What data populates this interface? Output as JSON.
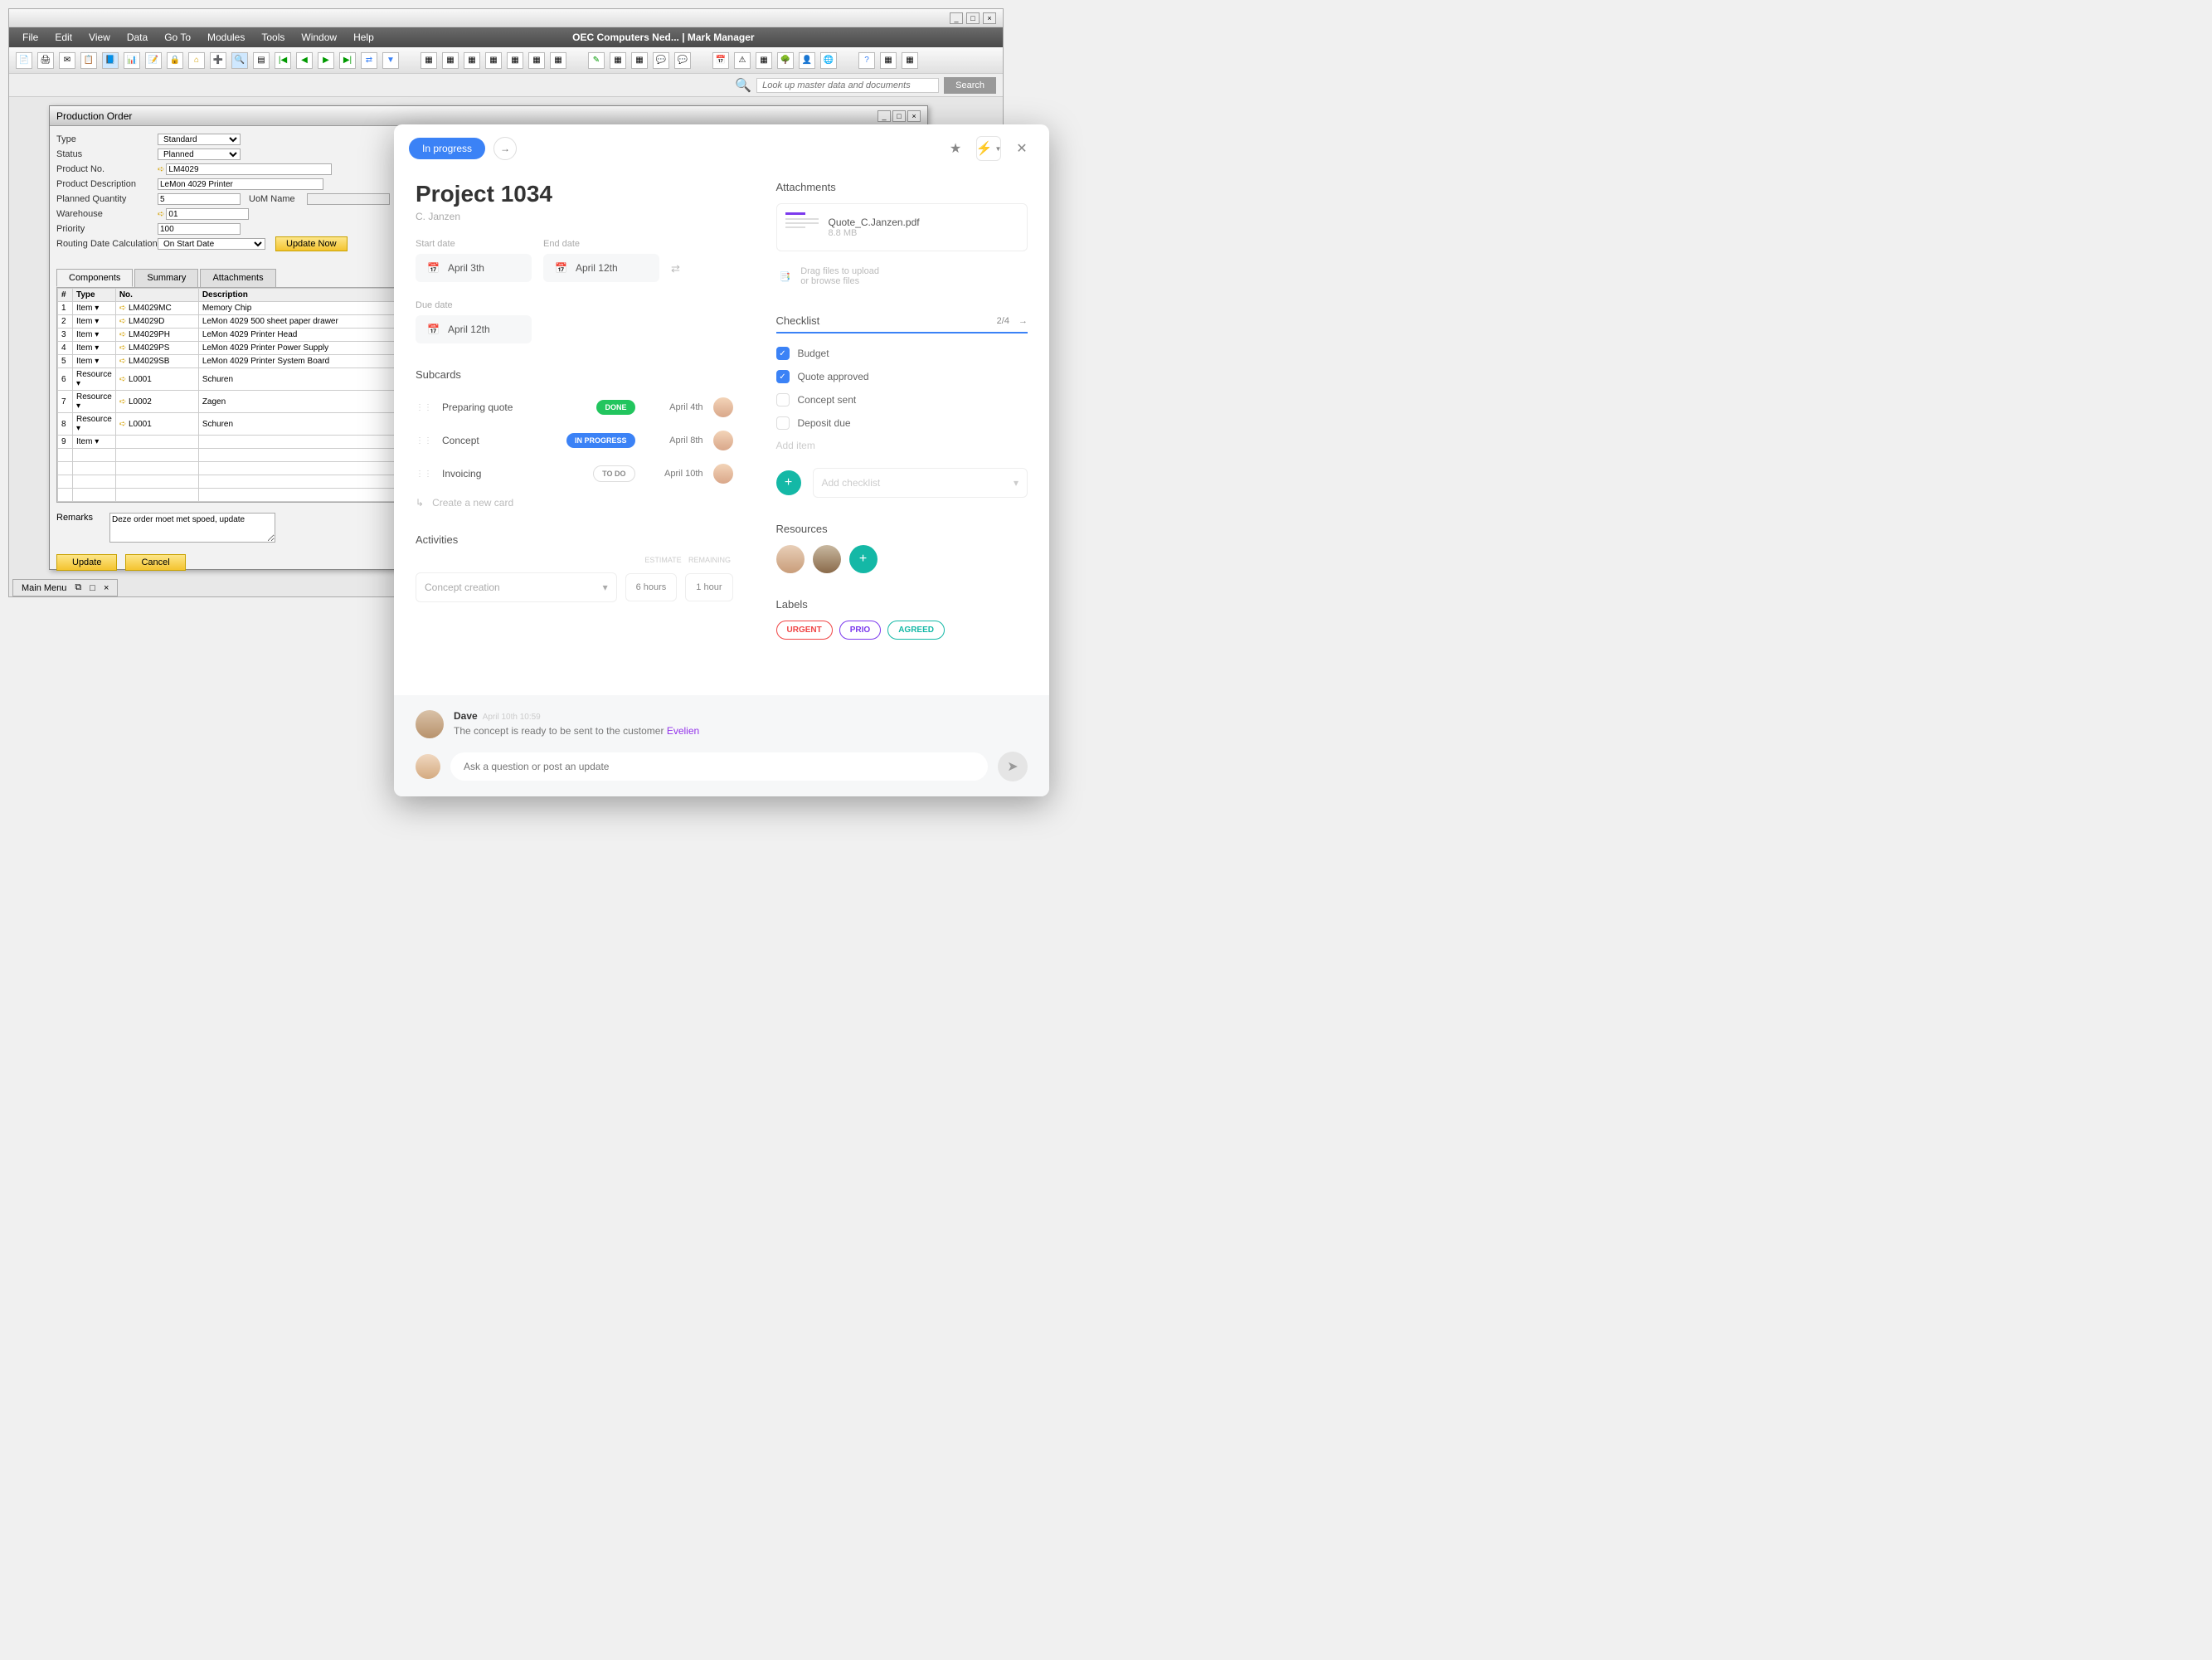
{
  "erp": {
    "menus": [
      "File",
      "Edit",
      "View",
      "Data",
      "Go To",
      "Modules",
      "Tools",
      "Window",
      "Help"
    ],
    "title": "OEC Computers Ned... | Mark Manager",
    "search_placeholder": "Look up master data and documents",
    "search_btn": "Search",
    "mainmenu_tab": "Main Menu"
  },
  "prodOrder": {
    "title": "Production Order",
    "fields": {
      "type_lbl": "Type",
      "type_val": "Standard",
      "status_lbl": "Status",
      "status_val": "Planned",
      "productno_lbl": "Product No.",
      "productno_val": "LM4029",
      "desc_lbl": "Product Description",
      "desc_val": "LeMon 4029 Printer",
      "qty_lbl": "Planned Quantity",
      "qty_val": "5",
      "uom_lbl": "UoM Name",
      "wh_lbl": "Warehouse",
      "wh_val": "01",
      "prio_lbl": "Priority",
      "prio_val": "100",
      "route_lbl": "Routing Date Calculation",
      "route_val": "On Start Date",
      "update_now": "Update Now"
    },
    "tabs": {
      "components": "Components",
      "summary": "Summary",
      "attachments": "Attachments"
    },
    "cols": {
      "n": "#",
      "type": "Type",
      "no": "No.",
      "desc": "Description"
    },
    "rows": [
      {
        "n": "1",
        "type": "Item",
        "no": "LM4029MC",
        "desc": "Memory Chip"
      },
      {
        "n": "2",
        "type": "Item",
        "no": "LM4029D",
        "desc": "LeMon 4029 500 sheet paper drawer"
      },
      {
        "n": "3",
        "type": "Item",
        "no": "LM4029PH",
        "desc": "LeMon 4029 Printer Head"
      },
      {
        "n": "4",
        "type": "Item",
        "no": "LM4029PS",
        "desc": "LeMon 4029 Printer Power Supply"
      },
      {
        "n": "5",
        "type": "Item",
        "no": "LM4029SB",
        "desc": "LeMon 4029 Printer System Board"
      },
      {
        "n": "6",
        "type": "Resource",
        "no": "L0001",
        "desc": "Schuren"
      },
      {
        "n": "7",
        "type": "Resource",
        "no": "L0002",
        "desc": "Zagen"
      },
      {
        "n": "8",
        "type": "Resource",
        "no": "L0001",
        "desc": "Schuren"
      },
      {
        "n": "9",
        "type": "Item",
        "no": "",
        "desc": ""
      }
    ],
    "remarks_lbl": "Remarks",
    "remarks_val": "Deze order moet met spoed, update",
    "update_btn": "Update",
    "cancel_btn": "Cancel"
  },
  "project": {
    "status": "In progress",
    "title": "Project 1034",
    "subtitle": "C. Janzen",
    "dates": {
      "start_lbl": "Start date",
      "start_val": "April 3th",
      "end_lbl": "End date",
      "end_val": "April 12th",
      "due_lbl": "Due date",
      "due_val": "April 12th"
    },
    "subcards_title": "Subcards",
    "subcards": [
      {
        "name": "Preparing quote",
        "status": "DONE",
        "date": "April 4th"
      },
      {
        "name": "Concept",
        "status": "IN PROGRESS",
        "date": "April 8th"
      },
      {
        "name": "Invoicing",
        "status": "TO DO",
        "date": "April 10th"
      }
    ],
    "create_card": "Create a new card",
    "activities": {
      "title": "Activities",
      "estimate_h": "ESTIMATE",
      "remaining_h": "REMAINING",
      "select": "Concept creation",
      "estimate": "6 hours",
      "remaining": "1 hour"
    },
    "attachments": {
      "title": "Attachments",
      "file": "Quote_C.Janzen.pdf",
      "size": "8.8 MB",
      "drop1": "Drag files to upload",
      "drop2": "or browse files"
    },
    "checklist": {
      "title": "Checklist",
      "count": "2/4",
      "items": [
        {
          "label": "Budget",
          "checked": true
        },
        {
          "label": "Quote approved",
          "checked": true
        },
        {
          "label": "Concept sent",
          "checked": false
        },
        {
          "label": "Deposit due",
          "checked": false
        }
      ],
      "add_item": "Add item",
      "add_checklist": "Add checklist"
    },
    "resources_title": "Resources",
    "labels_title": "Labels",
    "labels": {
      "urgent": "URGENT",
      "prio": "PRIO",
      "agreed": "AGREED"
    },
    "comment": {
      "author": "Dave",
      "timestamp": "April 10th 10:59",
      "text": "The concept is ready to be sent to the customer ",
      "mention": "Evelien"
    },
    "reply_placeholder": "Ask a question or post an update"
  }
}
